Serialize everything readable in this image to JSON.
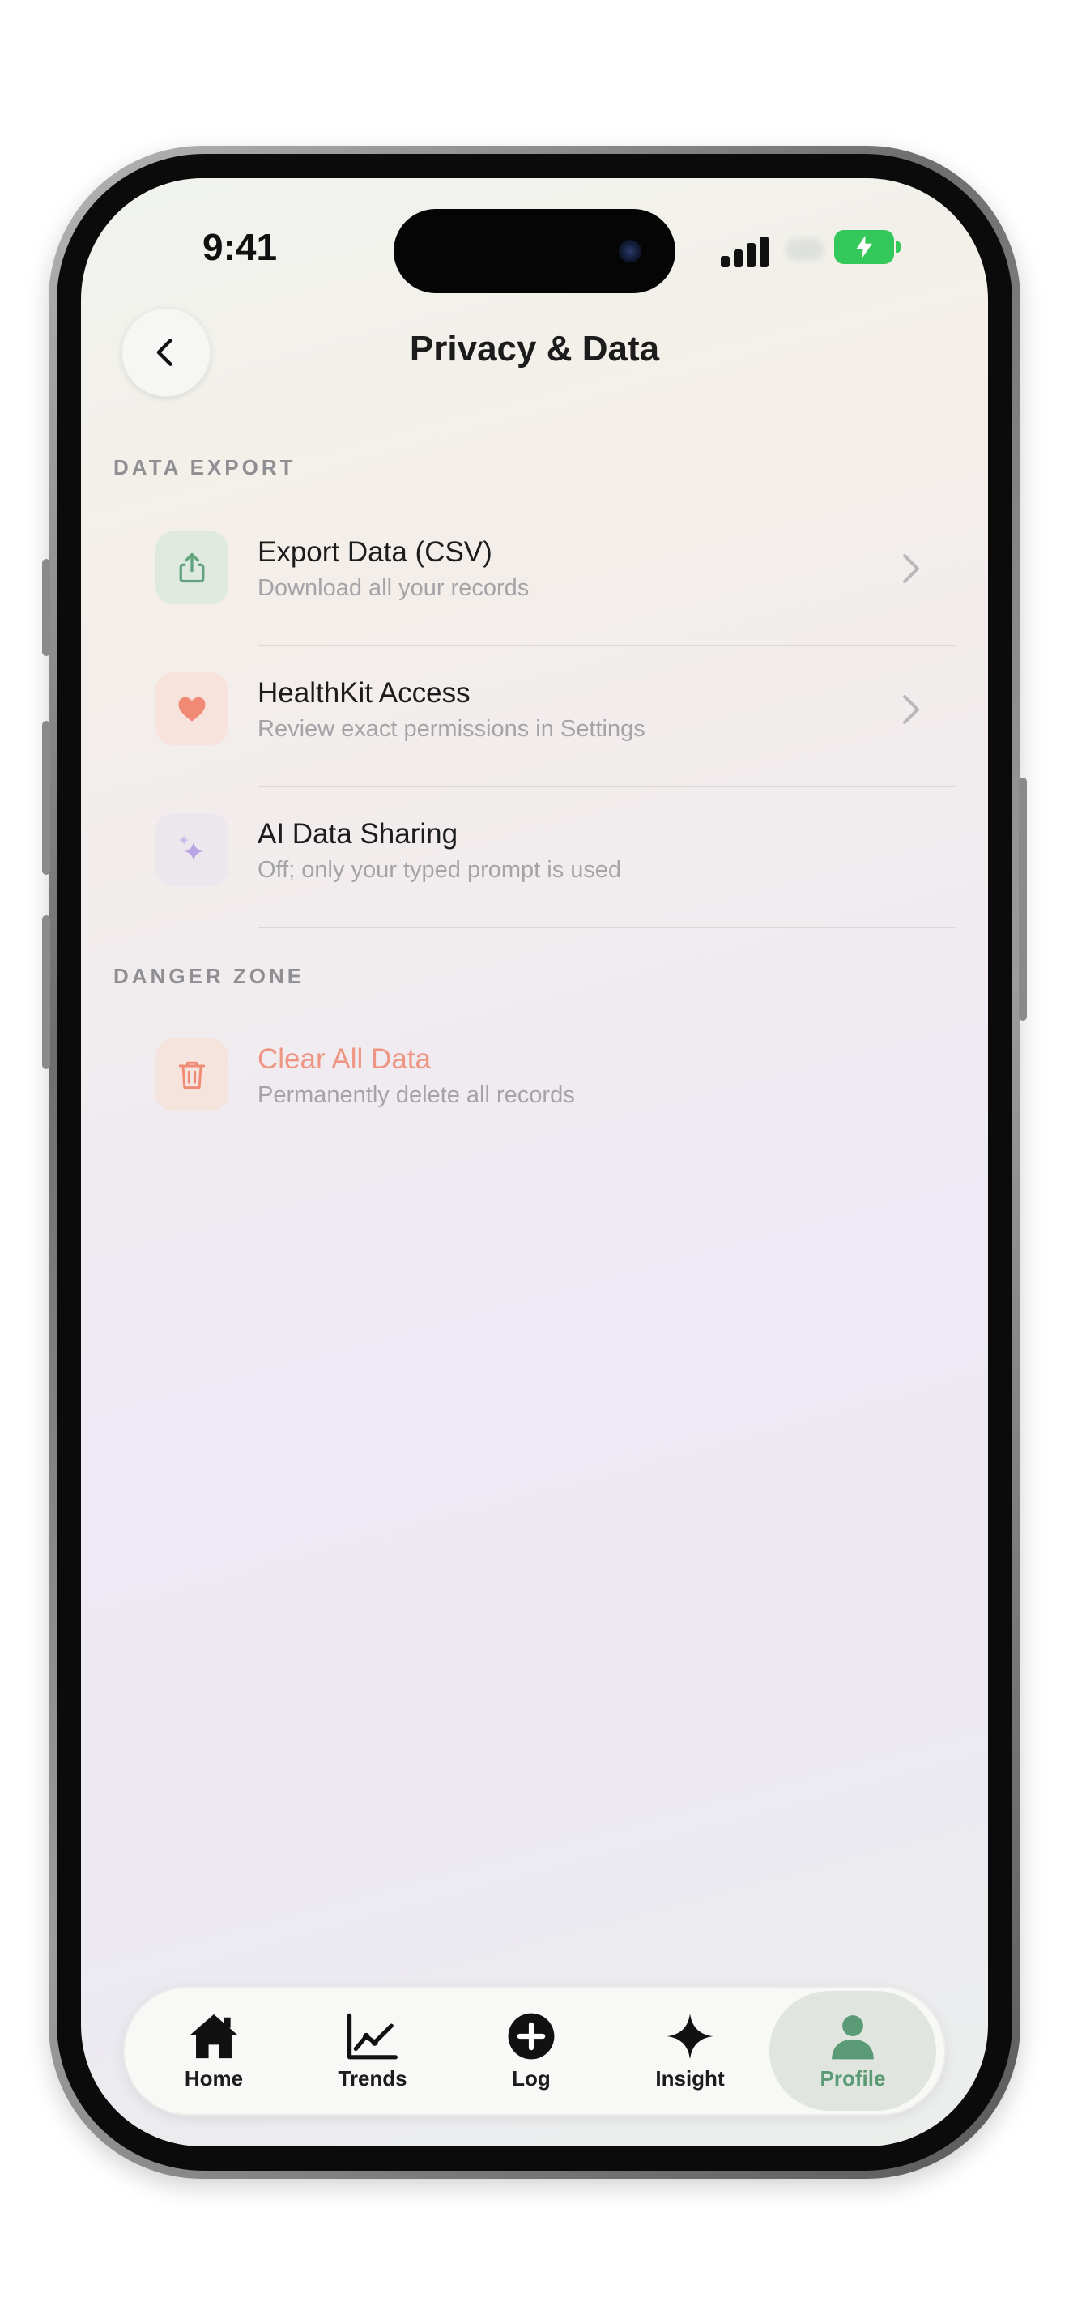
{
  "status_bar": {
    "time": "9:41"
  },
  "header": {
    "title": "Privacy & Data",
    "back_icon": "chevron-left-icon"
  },
  "sections": [
    {
      "title": "DATA EXPORT",
      "rows": [
        {
          "title": "Export Data (CSV)",
          "subtitle": "Download all your records",
          "icon": "share-icon",
          "icon_color": "#5fa47c",
          "icon_bg": "#dfe9e0",
          "has_chevron": true
        },
        {
          "title": "HealthKit Access",
          "subtitle": "Review exact permissions in Settings",
          "icon": "heart-icon",
          "icon_color": "#f08a74",
          "icon_bg": "#f7e3dc",
          "has_chevron": true
        },
        {
          "title": "AI Data Sharing",
          "subtitle": "Off; only your typed prompt is used",
          "icon": "sparkles-icon",
          "icon_color": "#b8a4e4",
          "icon_bg": "#ece7ed",
          "has_chevron": false
        }
      ]
    },
    {
      "title": "DANGER ZONE",
      "rows": [
        {
          "title": "Clear All Data",
          "subtitle": "Permanently delete all records",
          "icon": "trash-icon",
          "icon_color": "#f08a74",
          "icon_bg": "#f5e3dd",
          "title_color": "#ef9583",
          "has_chevron": false
        }
      ]
    }
  ],
  "tab_bar": {
    "active": "Profile",
    "tabs": [
      {
        "label": "Home",
        "icon": "home-icon"
      },
      {
        "label": "Trends",
        "icon": "trends-chart-icon"
      },
      {
        "label": "Log",
        "icon": "plus-circle-icon"
      },
      {
        "label": "Insight",
        "icon": "sparkle-icon"
      },
      {
        "label": "Profile",
        "icon": "person-icon"
      }
    ]
  },
  "colors": {
    "accent": "#5a9a74",
    "danger": "#ef9583",
    "battery": "#34c759"
  }
}
